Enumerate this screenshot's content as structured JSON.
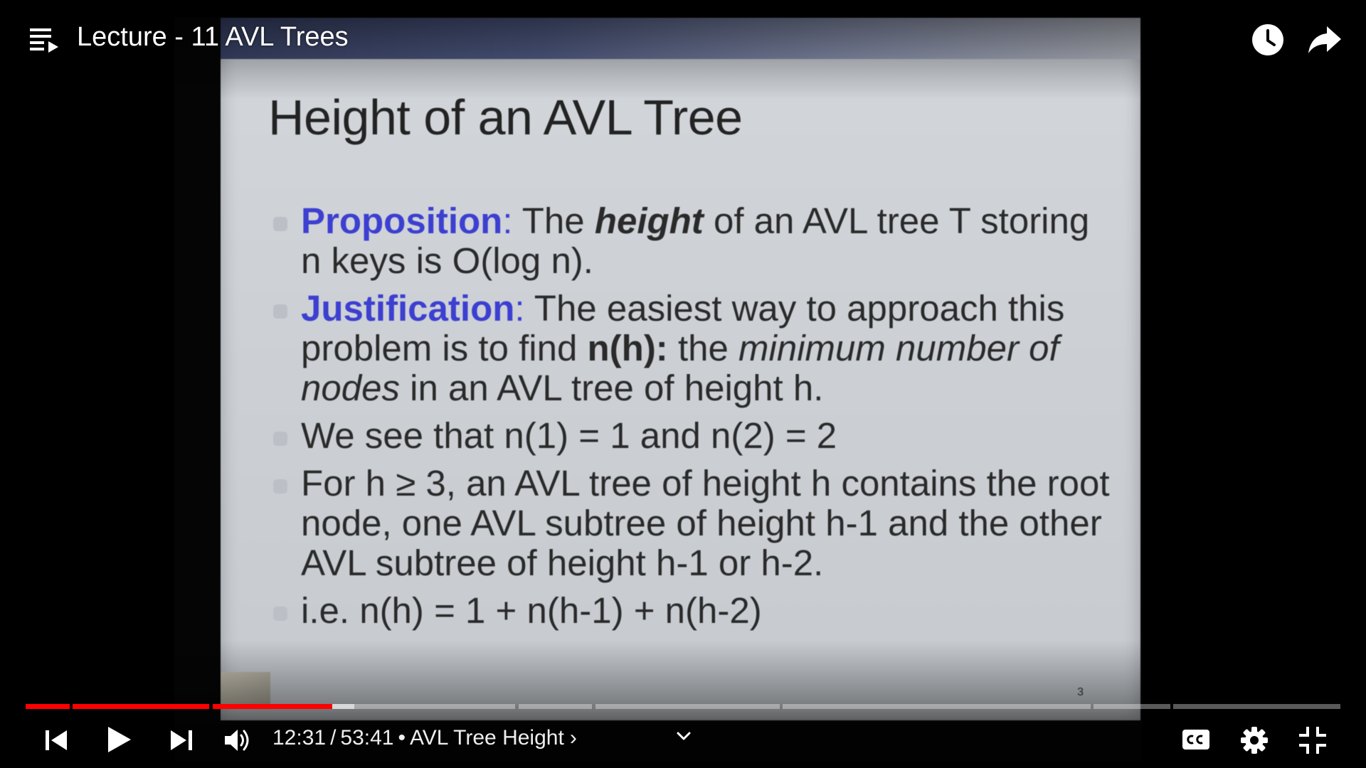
{
  "video": {
    "title": "Lecture - 11 AVL Trees"
  },
  "slide": {
    "title": "Height of an AVL Tree",
    "bullets": [
      {
        "k1": "Proposition",
        "k1_colon": ":",
        "t1": " The ",
        "t2": "height",
        "t3": " of an AVL tree T storing n keys is O(log n)."
      },
      {
        "k1": "Justification",
        "k1_colon": ":",
        "t1": " The easiest way to approach this problem is to find ",
        "t2": "n(h):",
        "t3": " the ",
        "t4": "minimum number of nodes",
        "t5": " in an AVL tree of height h."
      },
      {
        "t1": "We see that n(1) = 1 and n(2) = 2"
      },
      {
        "t1": "For h ≥ 3, an AVL tree of height h contains the root node, one AVL subtree of height h-1 and the other AVL subtree of height h-1 or h-2."
      },
      {
        "t1": "i.e. n(h) = 1 + n(h-1) + n(h-2)"
      }
    ],
    "page_number": "3"
  },
  "player": {
    "current_time": "12:31",
    "separator": "/",
    "duration": "53:41",
    "chapter_dot": "•",
    "chapter_title": "AVL Tree Height",
    "chapter_chevron": "›",
    "progress_fraction": 0.233,
    "buffered_fraction": 0.25
  },
  "icons": {
    "playlist": "playlist-icon",
    "watch_later": "clock-icon",
    "share": "share-icon",
    "previous": "skip-previous-icon",
    "play": "play-icon",
    "next": "skip-next-icon",
    "volume": "volume-icon",
    "expand": "chevron-down-icon",
    "captions": "cc-icon",
    "settings": "gear-icon",
    "exit_fullscreen": "exit-fullscreen-icon"
  },
  "colors": {
    "progress_played": "#ff0000",
    "keyword_blue": "#3c3fd0"
  }
}
